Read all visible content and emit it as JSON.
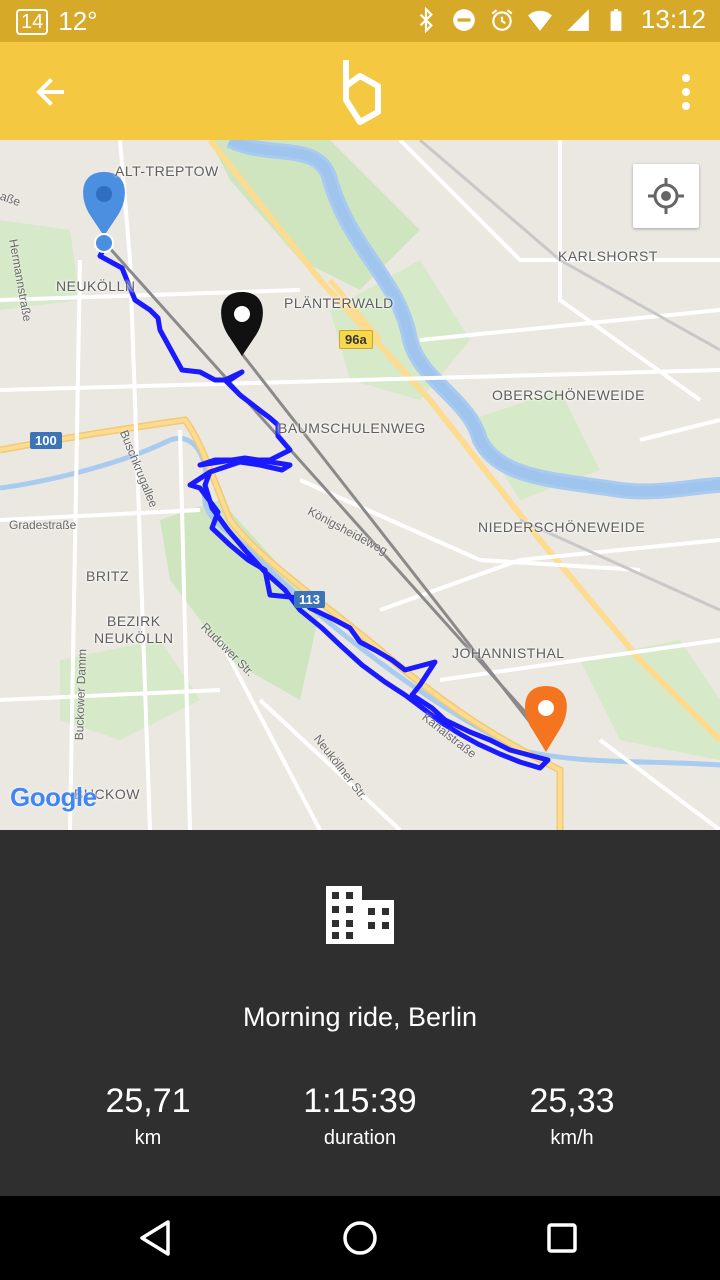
{
  "status_bar": {
    "notification_count": "14",
    "temperature": "12°",
    "time": "13:12",
    "icons": [
      "bluetooth-icon",
      "do-not-disturb-icon",
      "alarm-icon",
      "wifi-icon",
      "signal-icon",
      "battery-icon"
    ]
  },
  "app_bar": {
    "back_icon": "arrow-back-icon",
    "logo_icon": "app-logo-icon",
    "menu_icon": "more-vert-icon",
    "color": "#f5c842"
  },
  "map": {
    "labels": {
      "alt_treptow": "ALT-TREPTOW",
      "neukolln": "NEUKÖLLN",
      "planterwald": "PLÄNTERWALD",
      "karlshorst": "KARLSHORST",
      "oberschoneweide": "OBERSCHÖNEWEIDE",
      "baumschulenweg": "BAUMSCHULENWEG",
      "niederschoneweide": "NIEDERSCHÖNEWEIDE",
      "britz": "BRITZ",
      "bezirk": "BEZIRK",
      "neukolln2": "NEUKÖLLN",
      "johannisthal": "JOHANNISTHAL",
      "buckow": "BUCKOW"
    },
    "roads": {
      "hermannstrasse": "Hermannstraße",
      "buschkrugallee": "Buschkrugallee",
      "gradestrasse": "Gradestraße",
      "konigsheideweg": "Königsheideweg",
      "rudower": "Rudower Str.",
      "buckower_damm": "Buckower Damm",
      "kanalstrasse": "Kanalstraße",
      "neukollner_str": "Neuköllner Str.",
      "strasse_edge": "aße"
    },
    "shields": {
      "a100": "100",
      "b96a": "96a",
      "b113": "113"
    },
    "attribution": "Google",
    "route_color": "#1a1aff",
    "start_marker_color": "#4a8fe0",
    "end_marker_color": "#f57420"
  },
  "ride": {
    "icon": "building-icon",
    "title": "Morning ride, Berlin",
    "stats": [
      {
        "value": "25,71",
        "label": "km"
      },
      {
        "value": "1:15:39",
        "label": "duration"
      },
      {
        "value": "25,33",
        "label": "km/h"
      }
    ]
  },
  "nav_bar": {
    "icons": [
      "back-triangle-icon",
      "home-circle-icon",
      "recents-square-icon"
    ]
  }
}
